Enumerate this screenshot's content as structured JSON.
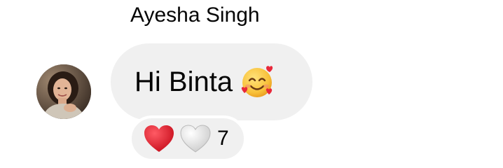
{
  "message": {
    "sender_name": "Ayesha Singh",
    "text": "Hi Binta",
    "emoji": "smiling-face-with-hearts",
    "avatar": "profile-photo"
  },
  "reactions": {
    "icons": [
      "red-heart-icon",
      "white-heart-icon"
    ],
    "count": "7"
  },
  "colors": {
    "bubble_bg": "#f0f0f0",
    "text": "#050505",
    "red_heart": "#e0202e"
  }
}
